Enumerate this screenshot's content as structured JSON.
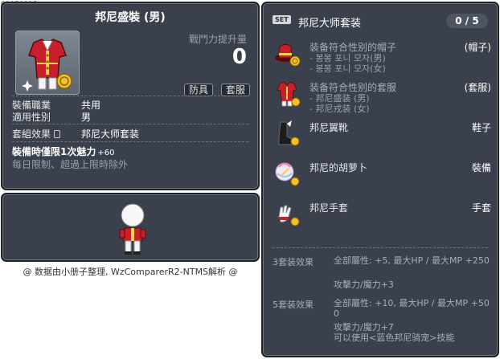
{
  "item_id": "01050312",
  "item": {
    "title": "邦尼盛裝 (男)",
    "power_label": "戰鬥力提升量",
    "power_value": "0",
    "tags": [
      "防具",
      "套服"
    ],
    "job_label": "裝備職業",
    "job_value": "共用",
    "gender_label": "適用性別",
    "gender_value": "男",
    "set_effect_label": "套組效果",
    "set_effect_value": "邦尼大师套装",
    "charm_text": "裝備時僅限1次魅力",
    "charm_value": "+60",
    "daily_text": "每日限制、超過上限時除外"
  },
  "footer": "@ 数据由小册子整理, WzComparerR2-NTMS解析 @",
  "set": {
    "badge": "SET",
    "title": "邦尼大师套装",
    "progress": "0 / 5",
    "pieces": [
      {
        "name": "装备符合性别的帽子",
        "slot": "(帽子)",
        "subs": [
          "- 봉봉 포니 모자(男)",
          "- 봉봉 포니 모자(女)"
        ]
      },
      {
        "name": "装备符合性别的套服",
        "slot": "(套服)",
        "subs": [
          "- 邦尼盛装 (男)",
          "- 邦尼戎装 (女)"
        ]
      },
      {
        "name": "邦尼翼靴",
        "slot": "鞋子",
        "subs": []
      },
      {
        "name": "邦尼的胡萝卜",
        "slot": "裝備",
        "subs": []
      },
      {
        "name": "邦尼手套",
        "slot": "手套",
        "subs": []
      }
    ],
    "effects": [
      {
        "label": "3套装效果",
        "lines": [
          "全部屬性: +5, 最大HP / 最大MP  +250",
          "攻擊力/魔力+3"
        ]
      },
      {
        "label": "5套装效果",
        "lines": [
          "全部屬性: +10, 最大HP / 最大MP  +500",
          "攻擊力/魔力+7",
          "可以使用<蓝色邦尼骑宠>技能"
        ]
      }
    ]
  },
  "colors": {
    "panel": "#3a414d",
    "border": "#1e232a",
    "text": "#e8e8e8",
    "muted": "#9aa0a9"
  }
}
